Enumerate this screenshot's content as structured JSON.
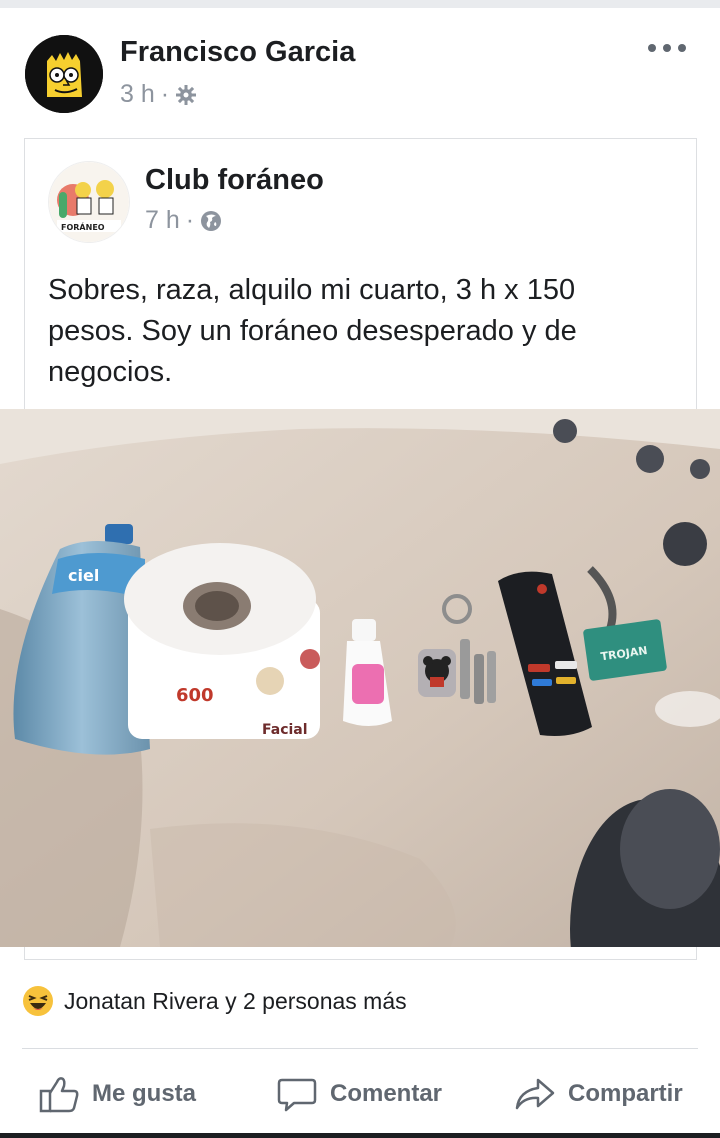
{
  "post": {
    "author": "Francisco Garcia",
    "time": "3 h",
    "dot": "·",
    "privacy_icon": "gear-icon"
  },
  "shared": {
    "page_name": "Club foráneo",
    "time": "7 h",
    "dot": "·",
    "privacy_icon": "globe-icon",
    "avatar_text": "FORÁNEO",
    "text": "Sobres, raza, alquilo mi cuarto, 3 h x 150 pesos. Soy un foráneo desesperado y de negocios."
  },
  "photo": {
    "bottle_label": "ciel",
    "roll_number": "600",
    "roll_brand": "Facial",
    "condom_brand": "TROJAN"
  },
  "reactions": {
    "emoji": "laughing-emoji",
    "text": "Jonatan Rivera y 2 personas más"
  },
  "actions": {
    "like": "Me gusta",
    "comment": "Comentar",
    "share": "Compartir"
  },
  "colors": {
    "text": "#1c1e21",
    "meta": "#8d949e",
    "action": "#606770",
    "bed": "#d8cdc2"
  }
}
